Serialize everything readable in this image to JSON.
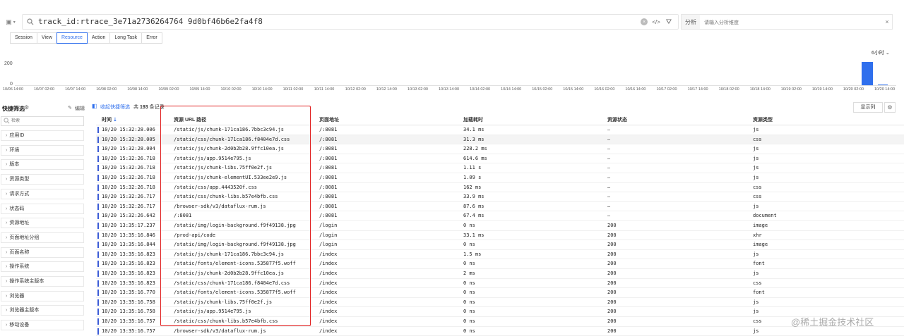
{
  "search": {
    "query": "track_id:rtrace_3e71a2736264764 9d0bf46b6e2fa4f8",
    "analysis_label": "分析",
    "analysis_placeholder": "请输入分析维度"
  },
  "tabs": [
    {
      "label": "Session",
      "active": false
    },
    {
      "label": "View",
      "active": false
    },
    {
      "label": "Resource",
      "active": true
    },
    {
      "label": "Action",
      "active": false
    },
    {
      "label": "Long Task",
      "active": false
    },
    {
      "label": "Error",
      "active": false
    }
  ],
  "histogram": {
    "time_range_label": "6小时 ⌄",
    "y_ticks": [
      "200",
      "0"
    ],
    "x_ticks": [
      "10/06 14:00",
      "10/07 02:00",
      "10/07 14:00",
      "10/08 02:00",
      "10/08 14:00",
      "10/09 02:00",
      "10/09 14:00",
      "10/10 02:00",
      "10/10 14:00",
      "10/11 02:00",
      "10/11 14:00",
      "10/12 02:00",
      "10/12 14:00",
      "10/13 02:00",
      "10/13 14:00",
      "10/14 02:00",
      "10/14 14:00",
      "10/15 02:00",
      "10/15 14:00",
      "10/16 02:00",
      "10/16 14:00",
      "10/17 02:00",
      "10/17 14:00",
      "10/18 02:00",
      "10/18 14:00",
      "10/19 02:00",
      "10/19 14:00",
      "10/20 02:00",
      "10/20 14:00"
    ],
    "bars": [
      {
        "label": "10/20 08:00",
        "value": 200
      },
      {
        "label": "10/20 14:00",
        "value": 8
      }
    ],
    "y_max": 240
  },
  "sidebar": {
    "title": "快捷筛选",
    "edit_label": "编辑",
    "search_placeholder": "检索",
    "facets": [
      "应用ID",
      "环境",
      "版本",
      "资源类型",
      "请求方式",
      "状态码",
      "资源地址",
      "页面地址分组",
      "页面名称",
      "操作系统",
      "操作系统主版本",
      "浏览器",
      "浏览器主版本",
      "移动设备"
    ]
  },
  "list": {
    "quick_filter_label": "收起快捷筛选",
    "count_prefix": "共",
    "count": "193",
    "count_suffix": "条记录",
    "show_columns_label": "显示列"
  },
  "table": {
    "columns": {
      "time": "时间",
      "url": "资源 URL 路径",
      "page": "页面地址",
      "duration": "加载耗时",
      "status": "资源状态",
      "type": "资源类型"
    },
    "rows": [
      {
        "time": "10/20 15:32:28.006",
        "url": "/static/js/chunk-171ca186.7bbc3c94.js",
        "page": "/:8081",
        "duration": "34.1 ms",
        "status": "—",
        "type": "js"
      },
      {
        "time": "10/20 15:32:28.005",
        "url": "/static/css/chunk-171ca186.f8404e7d.css",
        "page": "/:8081",
        "duration": "31.3 ms",
        "status": "—",
        "type": "css"
      },
      {
        "time": "10/20 15:32:28.004",
        "url": "/static/js/chunk-2d0b2b28.9ffc10ea.js",
        "page": "/:8081",
        "duration": "228.2 ms",
        "status": "—",
        "type": "js"
      },
      {
        "time": "10/20 15:32:26.718",
        "url": "/static/js/app.9514e795.js",
        "page": "/:8081",
        "duration": "614.6 ms",
        "status": "—",
        "type": "js"
      },
      {
        "time": "10/20 15:32:26.718",
        "url": "/static/js/chunk-libs.75ff0e2f.js",
        "page": "/:8081",
        "duration": "1.11 s",
        "status": "—",
        "type": "js"
      },
      {
        "time": "10/20 15:32:26.718",
        "url": "/static/js/chunk-elementUI.533ee2e9.js",
        "page": "/:8081",
        "duration": "1.09 s",
        "status": "—",
        "type": "js"
      },
      {
        "time": "10/20 15:32:26.718",
        "url": "/static/css/app.4443520f.css",
        "page": "/:8081",
        "duration": "162 ms",
        "status": "—",
        "type": "css"
      },
      {
        "time": "10/20 15:32:26.717",
        "url": "/static/css/chunk-libs.b57e4bfb.css",
        "page": "/:8081",
        "duration": "33.9 ms",
        "status": "—",
        "type": "css"
      },
      {
        "time": "10/20 15:32:26.717",
        "url": "/browser-sdk/v3/dataflux-rum.js",
        "page": "/:8081",
        "duration": "87.6 ms",
        "status": "—",
        "type": "js"
      },
      {
        "time": "10/20 15:32:26.642",
        "url": "/:8081",
        "page": "/:8081",
        "duration": "67.4 ms",
        "status": "—",
        "type": "document"
      },
      {
        "time": "10/20 13:35:17.237",
        "url": "/static/img/login-background.f9f49138.jpg",
        "page": "/login",
        "duration": "0 ns",
        "status": "200",
        "type": "image"
      },
      {
        "time": "10/20 13:35:16.846",
        "url": "/prod-api/code",
        "page": "/login",
        "duration": "33.1 ms",
        "status": "200",
        "type": "xhr"
      },
      {
        "time": "10/20 13:35:16.844",
        "url": "/static/img/login-background.f9f49138.jpg",
        "page": "/login",
        "duration": "0 ns",
        "status": "200",
        "type": "image"
      },
      {
        "time": "10/20 13:35:16.823",
        "url": "/static/js/chunk-171ca186.7bbc3c94.js",
        "page": "/index",
        "duration": "1.5 ms",
        "status": "200",
        "type": "js"
      },
      {
        "time": "10/20 13:35:16.823",
        "url": "/static/fonts/element-icons.535877f5.woff",
        "page": "/index",
        "duration": "0 ns",
        "status": "200",
        "type": "font"
      },
      {
        "time": "10/20 13:35:16.823",
        "url": "/static/js/chunk-2d0b2b28.9ffc10ea.js",
        "page": "/index",
        "duration": "2 ms",
        "status": "200",
        "type": "js"
      },
      {
        "time": "10/20 13:35:16.823",
        "url": "/static/css/chunk-171ca186.f8404e7d.css",
        "page": "/index",
        "duration": "0 ns",
        "status": "200",
        "type": "css"
      },
      {
        "time": "10/20 13:35:16.770",
        "url": "/static/fonts/element-icons.535877f5.woff",
        "page": "/index",
        "duration": "0 ns",
        "status": "200",
        "type": "font"
      },
      {
        "time": "10/20 13:35:16.758",
        "url": "/static/js/chunk-libs.75ff0e2f.js",
        "page": "/index",
        "duration": "0 ns",
        "status": "200",
        "type": "js"
      },
      {
        "time": "10/20 13:35:16.758",
        "url": "/static/js/app.9514e795.js",
        "page": "/index",
        "duration": "0 ns",
        "status": "200",
        "type": "js"
      },
      {
        "time": "10/20 13:35:16.757",
        "url": "/static/css/chunk-libs.b57e4bfb.css",
        "page": "/index",
        "duration": "0 ns",
        "status": "200",
        "type": "css"
      },
      {
        "time": "10/20 13:35:16.757",
        "url": "/browser-sdk/v3/dataflux-rum.js",
        "page": "/index",
        "duration": "0 ns",
        "status": "200",
        "type": "js"
      }
    ]
  },
  "watermark": "@稀土掘金技术社区",
  "colors": {
    "accent": "#2f6fed",
    "highlight_box": "#e02020",
    "row_marker": "#3b5bd6"
  }
}
